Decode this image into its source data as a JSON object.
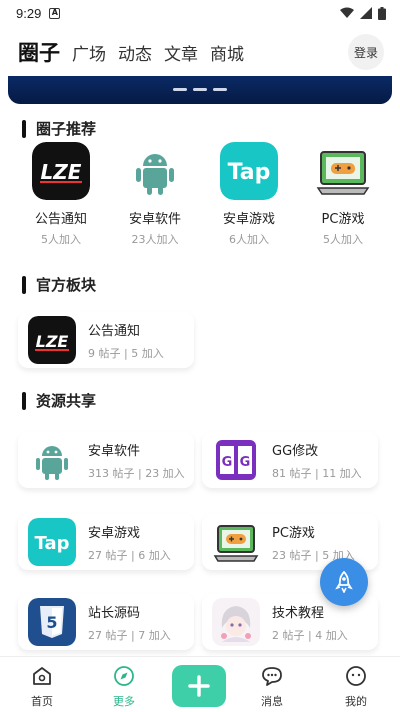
{
  "status": {
    "time": "9:29"
  },
  "topnav": {
    "tabs": [
      "圈子",
      "广场",
      "动态",
      "文章",
      "商城"
    ],
    "login_label": "登录"
  },
  "sections": {
    "recommend": "圈子推荐",
    "official": "官方板块",
    "resources": "资源共享"
  },
  "recommend": [
    {
      "name": "公告通知",
      "count": "5人加入",
      "icon": "lze-logo-icon"
    },
    {
      "name": "安卓软件",
      "count": "23人加入",
      "icon": "android-icon"
    },
    {
      "name": "安卓游戏",
      "count": "6人加入",
      "icon": "tap-icon"
    },
    {
      "name": "PC游戏",
      "count": "5人加入",
      "icon": "gamepad-icon"
    }
  ],
  "official": [
    {
      "name": "公告通知",
      "meta": "9 帖子 | 5 加入",
      "icon": "lze-logo-icon"
    }
  ],
  "resources": [
    {
      "name": "安卓软件",
      "meta": "313 帖子 | 23 加入",
      "icon": "android-icon"
    },
    {
      "name": "GG修改",
      "meta": "81 帖子 | 11 加入",
      "icon": "gg-icon"
    },
    {
      "name": "安卓游戏",
      "meta": "27 帖子 | 6 加入",
      "icon": "tap-icon"
    },
    {
      "name": "PC游戏",
      "meta": "23 帖子 | 5 加入",
      "icon": "gamepad-icon"
    },
    {
      "name": "站长源码",
      "meta": "27 帖子 | 7 加入",
      "icon": "html5-icon"
    },
    {
      "name": "技术教程",
      "meta": "2 帖子 | 4 加入",
      "icon": "anime-avatar-icon"
    }
  ],
  "bottomnav": {
    "home": "首页",
    "more": "更多",
    "messages": "消息",
    "mine": "我的"
  },
  "colors": {
    "accent": "#2bb68b",
    "fab": "#3a8ee6",
    "add_button": "#3fcfa8"
  }
}
